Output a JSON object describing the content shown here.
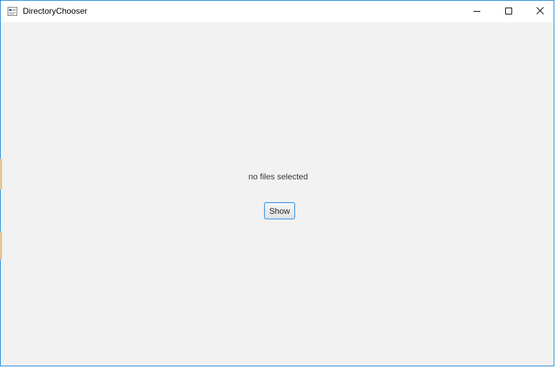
{
  "window": {
    "title": "DirectoryChooser",
    "controls": {
      "minimize": "minimize-icon",
      "maximize": "maximize-icon",
      "close": "close-icon"
    }
  },
  "main": {
    "status_text": "no files selected",
    "show_button_label": "Show"
  },
  "colors": {
    "window_border": "#1a88d6",
    "content_background": "#f2f2f2",
    "button_border": "#3a8fd8"
  }
}
